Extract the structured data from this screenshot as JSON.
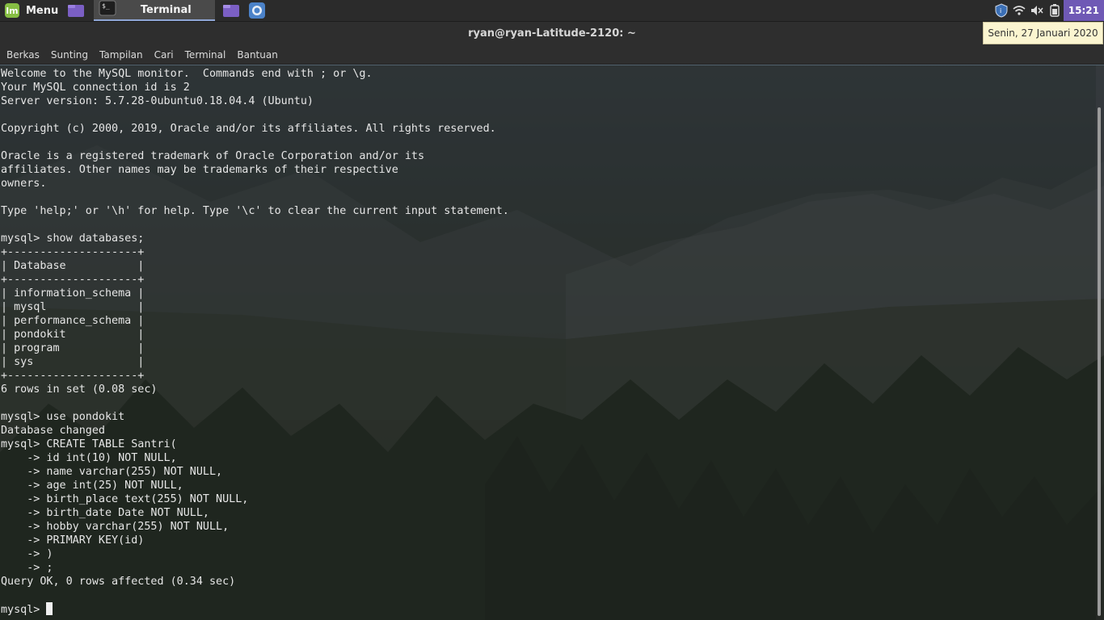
{
  "panel": {
    "menu_label": "Menu",
    "mint_logo_text": "lm",
    "launchers": [
      "folder-purple-icon",
      "terminal-icon",
      "files-icon",
      "chromium-icon"
    ],
    "active_task": "Terminal",
    "clock": "15:21",
    "tray_icons": [
      "shield-icon",
      "wifi-icon",
      "volume-icon",
      "battery-icon"
    ]
  },
  "window": {
    "title": "ryan@ryan-Latitude-2120: ~",
    "menu": [
      "Berkas",
      "Sunting",
      "Tampilan",
      "Cari",
      "Terminal",
      "Bantuan"
    ]
  },
  "tooltip": "Senin, 27 Januari 2020",
  "terminal": {
    "output": "Welcome to the MySQL monitor.  Commands end with ; or \\g.\nYour MySQL connection id is 2\nServer version: 5.7.28-0ubuntu0.18.04.4 (Ubuntu)\n\nCopyright (c) 2000, 2019, Oracle and/or its affiliates. All rights reserved.\n\nOracle is a registered trademark of Oracle Corporation and/or its\naffiliates. Other names may be trademarks of their respective\nowners.\n\nType 'help;' or '\\h' for help. Type '\\c' to clear the current input statement.\n\nmysql> show databases;\n+--------------------+\n| Database           |\n+--------------------+\n| information_schema |\n| mysql              |\n| performance_schema |\n| pondokit           |\n| program            |\n| sys                |\n+--------------------+\n6 rows in set (0.08 sec)\n\nmysql> use pondokit\nDatabase changed\nmysql> CREATE TABLE Santri(\n    -> id int(10) NOT NULL,\n    -> name varchar(255) NOT NULL,\n    -> age int(25) NOT NULL,\n    -> birth_place text(255) NOT NULL,\n    -> birth_date Date NOT NULL,\n    -> hobby varchar(255) NOT NULL,\n    -> PRIMARY KEY(id)\n    -> )\n    -> ;\nQuery OK, 0 rows affected (0.34 sec)\n\n",
    "prompt": "mysql> "
  }
}
